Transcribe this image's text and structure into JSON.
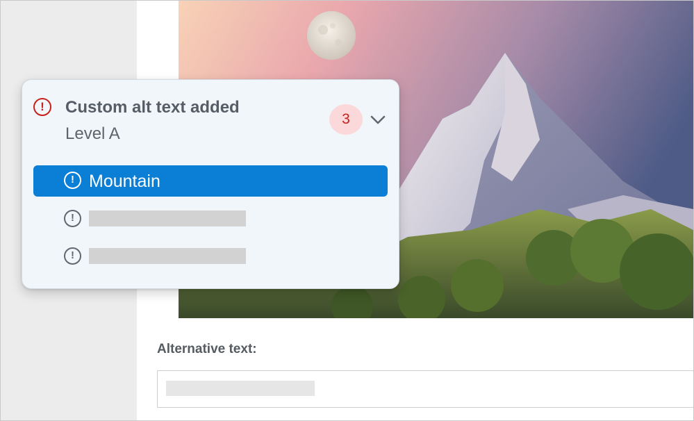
{
  "accessibility_panel": {
    "title": "Custom alt text added",
    "level": "Level A",
    "issue_count": "3",
    "items": [
      {
        "label": "Mountain",
        "selected": true,
        "icon": "exclamation-circle-icon"
      },
      {
        "label": "",
        "selected": false,
        "icon": "exclamation-circle-icon"
      },
      {
        "label": "",
        "selected": false,
        "icon": "exclamation-circle-icon"
      }
    ],
    "status_icon": "exclamation-circle-icon",
    "expand_icon": "chevron-down-icon"
  },
  "document": {
    "alt_text_label": "Alternative text:",
    "alt_text_value": ""
  },
  "colors": {
    "error": "#c8201a",
    "badge_background": "#fbd9da",
    "selected_item": "#0b7fd6",
    "card_background": "#f1f6fa",
    "sidebar": "#ececec"
  }
}
